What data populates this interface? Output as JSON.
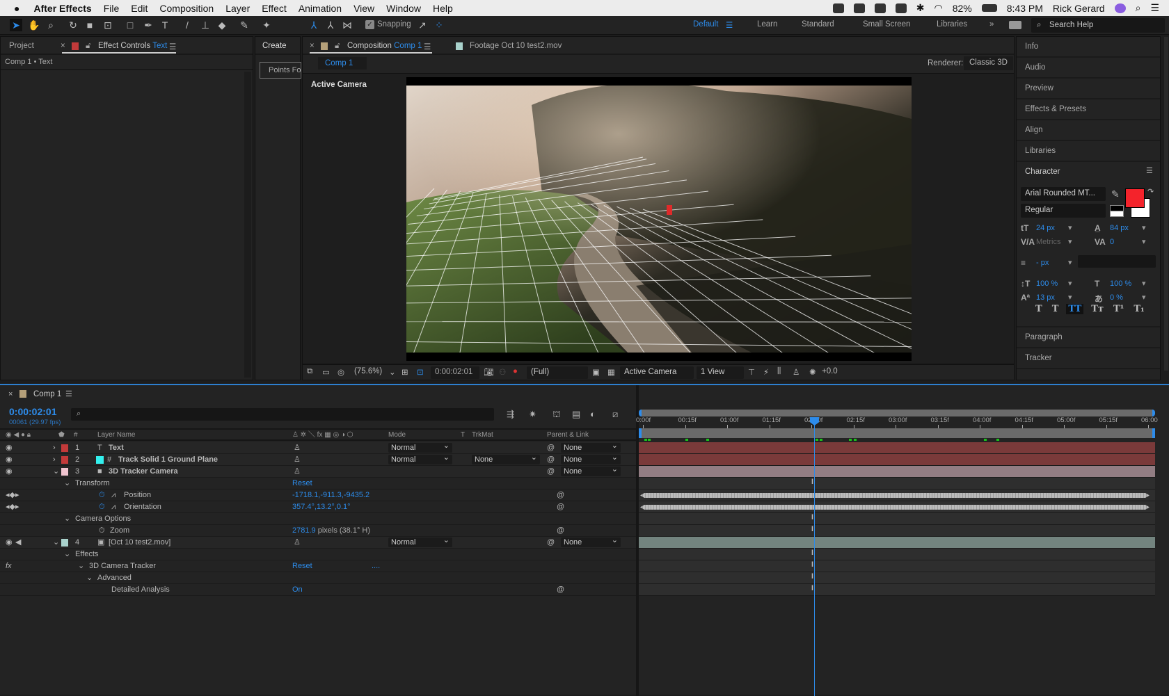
{
  "menubar": {
    "app": "After Effects",
    "items": [
      "File",
      "Edit",
      "Composition",
      "Layer",
      "Effect",
      "Animation",
      "View",
      "Window",
      "Help"
    ],
    "battery": "82%",
    "time": "8:43 PM",
    "user": "Rick Gerard"
  },
  "toolbar": {
    "snapping": "Snapping",
    "workspaces": [
      "Default",
      "Learn",
      "Standard",
      "Small Screen",
      "Libraries"
    ],
    "active_workspace": "Default",
    "search_placeholder": "Search Help"
  },
  "left_panel": {
    "tab_project": "Project",
    "tab_effect_controls": "Effect Controls",
    "effect_controls_target": "Text",
    "breadcrumb": "Comp 1 • Text"
  },
  "create_panel": {
    "title": "Create",
    "button": "Points Fo"
  },
  "viewer": {
    "tab_label": "Composition",
    "tab_comp": "Comp 1",
    "footage_tab": "Footage Oct 10 test2.mov",
    "subtab": "Comp 1",
    "renderer_label": "Renderer:",
    "renderer": "Classic 3D",
    "camera_label": "Active Camera",
    "bottom": {
      "zoom": "(75.6%)",
      "timecode": "0:00:02:01",
      "resolution": "(Full)",
      "camera": "Active Camera",
      "views": "1 View",
      "exposure": "+0.0"
    }
  },
  "right_panel": {
    "items_top": [
      "Info",
      "Audio",
      "Preview",
      "Effects & Presets",
      "Align",
      "Libraries"
    ],
    "character_title": "Character",
    "items_bottom": [
      "Paragraph",
      "Tracker"
    ],
    "character": {
      "font": "Arial Rounded MT...",
      "style": "Regular",
      "size": "24 px",
      "leading": "84 px",
      "kerning": "Metrics",
      "tracking": "0",
      "stroke": "- px",
      "vertical_scale": "100 %",
      "horizontal_scale": "100 %",
      "baseline_shift": "13 px",
      "tsume": "0 %",
      "fill_color": "#f4232b",
      "styles": [
        "T",
        "T",
        "TT",
        "Tт",
        "T¹",
        "T₁"
      ],
      "active_style": 2
    }
  },
  "timeline": {
    "tab": "Comp 1",
    "timecode": "0:00:02:01",
    "frames": "00061 (29.97 fps)",
    "columns": {
      "num": "#",
      "layer_name": "Layer Name",
      "mode": "Mode",
      "t": "T",
      "trkmat": "TrkMat",
      "parent": "Parent & Link"
    },
    "ruler": [
      "0:00f",
      "00:15f",
      "01:00f",
      "01:15f",
      "02:00f",
      "02:15f",
      "03:00f",
      "03:15f",
      "04:00f",
      "04:15f",
      "05:00f",
      "05:15f",
      "06:00"
    ],
    "current_time_sec": 2.033,
    "duration_sec": 6,
    "rows": [
      {
        "kind": "layer",
        "num": "1",
        "name": "Text",
        "label": "#c23a3a",
        "type_icon": "T",
        "mode": "Normal",
        "trkmat": "",
        "parent": "None",
        "bar": "#7a3a3a",
        "expanded": false
      },
      {
        "kind": "layer",
        "num": "2",
        "name": "Track Solid 1 Ground Plane",
        "label": "#c23a3a",
        "swatch": "#33f0ee",
        "type_icon": "#",
        "mode": "Normal",
        "trkmat": "None",
        "parent": "None",
        "bar": "#7a3a3a",
        "expanded": false
      },
      {
        "kind": "layer",
        "num": "3",
        "name": "3D Tracker Camera",
        "label": "#f0c4cf",
        "type_icon": "■",
        "mode": "",
        "trkmat": "",
        "parent": "None",
        "bar": "#927d83",
        "expanded": true
      },
      {
        "kind": "group",
        "indent": 1,
        "name": "Transform",
        "value": "Reset"
      },
      {
        "kind": "prop",
        "indent": 2,
        "name": "Position",
        "value": "-1718.1,-911.3,-9435.2",
        "keyed": true
      },
      {
        "kind": "prop",
        "indent": 2,
        "name": "Orientation",
        "value": "357.4°,13.2°,0.1°",
        "keyed": true
      },
      {
        "kind": "group",
        "indent": 1,
        "name": "Camera Options",
        "value": ""
      },
      {
        "kind": "prop",
        "indent": 2,
        "name": "Zoom",
        "value": "2781.9",
        "suffix": " pixels (38.1° H)"
      },
      {
        "kind": "layer",
        "num": "4",
        "name": "[Oct 10 test2.mov]",
        "label": "#a9d2cc",
        "type_icon": "▣",
        "mode": "Normal",
        "trkmat": "",
        "parent": "None",
        "bar": "#73847f",
        "expanded": true,
        "audio": true
      },
      {
        "kind": "group",
        "indent": 1,
        "name": "Effects",
        "value": ""
      },
      {
        "kind": "group",
        "indent": 2,
        "name": "3D Camera Tracker",
        "value": "Reset",
        "extra": "....",
        "fx": true
      },
      {
        "kind": "group",
        "indent": 3,
        "name": "Advanced",
        "value": ""
      },
      {
        "kind": "prop",
        "indent": 4,
        "name": "Detailed Analysis",
        "value": "On",
        "no_stopwatch": true
      }
    ]
  }
}
